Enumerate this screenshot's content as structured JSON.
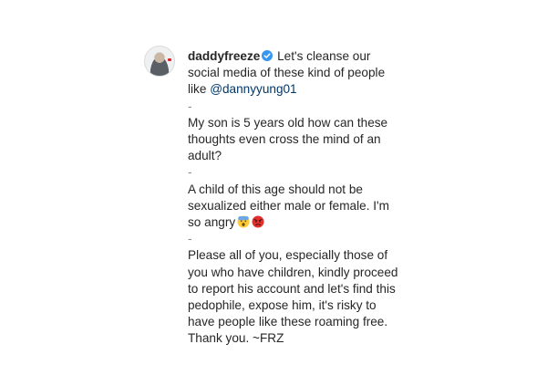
{
  "comment": {
    "username": "daddyfreeze",
    "verified": true,
    "intro_text": "Let's cleanse our social media of these kind of people like ",
    "mention": "@dannyyung01",
    "separator": "-",
    "paragraph_2": "My son is 5 years old how can these thoughts even cross the mind of an adult?",
    "paragraph_3": "A child of this age should not be sexualized either male or female. I'm so angry",
    "emojis": [
      "scared-face-icon",
      "angry-face-icon"
    ],
    "paragraph_4": "Please all of you, especially those of you who have children, kindly proceed to report his account and let's find this pedophile, expose him, it's risky to have people like these roaming free.",
    "signoff": "Thank you. ~FRZ"
  },
  "colors": {
    "text": "#262626",
    "mention": "#00376b",
    "verified": "#3897f0"
  }
}
